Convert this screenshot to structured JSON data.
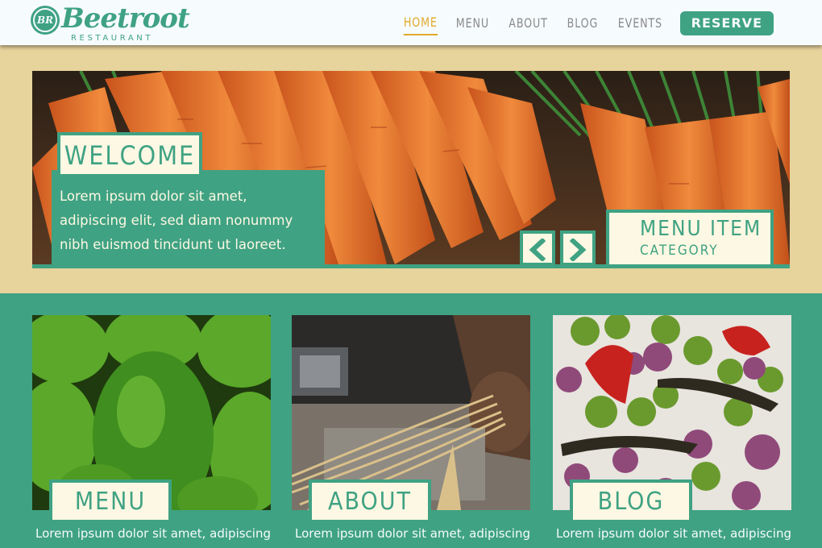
{
  "brand": {
    "name": "Beetroot",
    "subtitle": "RESTAURANT",
    "badge": "BR",
    "color": "#3fa283"
  },
  "nav": {
    "items": [
      {
        "label": "HOME",
        "active": true
      },
      {
        "label": "MENU",
        "active": false
      },
      {
        "label": "ABOUT",
        "active": false
      },
      {
        "label": "BLOG",
        "active": false
      },
      {
        "label": "EVENTS",
        "active": false
      }
    ],
    "reserve_label": "RESERVE",
    "active_color": "#e3a92c"
  },
  "hero": {
    "welcome_title": "WELCOME",
    "welcome_text": "Lorem ipsum dolor sit amet, adipiscing elit, sed diam nonummy nibh euismod tincidunt ut laoreet.",
    "menu_item_title": "MENU ITEM",
    "menu_item_category": "CATEGORY",
    "prev_icon": "chevron-left-icon",
    "next_icon": "chevron-right-icon"
  },
  "cards": [
    {
      "label": "MENU",
      "text": "Lorem ipsum dolor sit amet, adipiscing",
      "image": "avocados"
    },
    {
      "label": "ABOUT",
      "text": "Lorem ipsum dolor sit amet, adipiscing",
      "image": "pasta-making"
    },
    {
      "label": "BLOG",
      "text": "Lorem ipsum dolor sit amet, adipiscing",
      "image": "tomatillos-and-peppers"
    }
  ],
  "colors": {
    "primary_green": "#3fa283",
    "cream": "#fdf8e3",
    "sand": "#e7d39c",
    "header_bg": "#f6fbfd"
  }
}
